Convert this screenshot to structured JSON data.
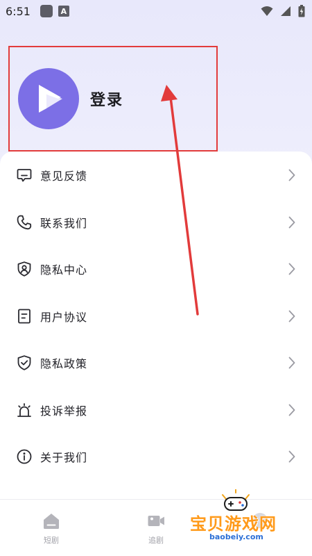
{
  "status_bar": {
    "time": "6:51",
    "a_icon_letter": "A"
  },
  "profile": {
    "login_label": "登录"
  },
  "menu": {
    "items": [
      {
        "label": "意见反馈",
        "icon": "feedback-icon"
      },
      {
        "label": "联系我们",
        "icon": "phone-icon"
      },
      {
        "label": "隐私中心",
        "icon": "privacy-user-shield-icon"
      },
      {
        "label": "用户协议",
        "icon": "document-icon"
      },
      {
        "label": "隐私政策",
        "icon": "shield-check-icon"
      },
      {
        "label": "投诉举报",
        "icon": "alarm-icon"
      },
      {
        "label": "关于我们",
        "icon": "info-icon"
      }
    ]
  },
  "bottom_nav": {
    "items": [
      {
        "label": "短剧",
        "icon": "home-icon"
      },
      {
        "label": "追剧",
        "icon": "video-icon"
      }
    ]
  },
  "watermark": {
    "title": "宝贝游戏网",
    "url": "baobeiy.com"
  },
  "colors": {
    "accent": "#7c6fe6",
    "annotation": "#e23b3b",
    "watermark_orange": "#ff9a1a"
  }
}
